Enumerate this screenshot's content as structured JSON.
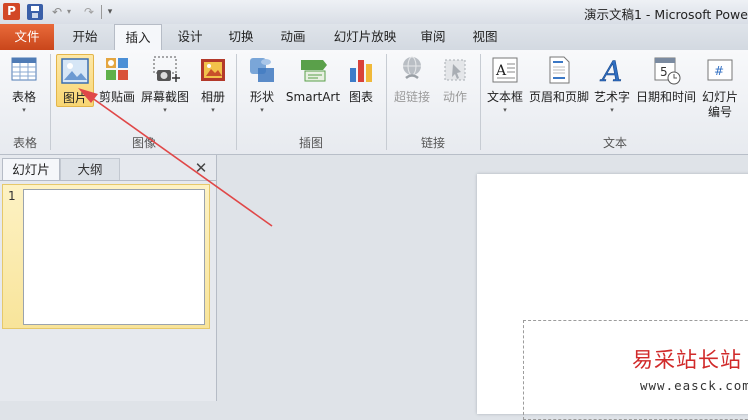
{
  "titlebar": {
    "app_icon": "P",
    "title": "演示文稿1 - Microsoft Powe",
    "icons": [
      "save-icon",
      "undo-icon",
      "redo-icon",
      "customize-qat-icon"
    ]
  },
  "tabs": [
    "文件",
    "开始",
    "插入",
    "设计",
    "切换",
    "动画",
    "幻灯片放映",
    "审阅",
    "视图"
  ],
  "active_tab": "插入",
  "ribbon": {
    "buttons": {
      "table": "表格",
      "picture": "图片",
      "clipart": "剪贴画",
      "screenshot": "屏幕截图",
      "album": "相册",
      "shapes": "形状",
      "smartart": "SmartArt",
      "chart": "图表",
      "hyperlink": "超链接",
      "action": "动作",
      "textbox": "文本框",
      "header_footer": "页眉和页脚",
      "wordart": "艺术字",
      "datetime": "日期和时间",
      "slide_number_1": "幻灯片",
      "slide_number_2": "编号"
    },
    "groups": {
      "tables": "表格",
      "images": "图像",
      "illustrations": "插图",
      "links": "链接",
      "text": "文本"
    }
  },
  "left_pane": {
    "tab_slides": "幻灯片",
    "tab_outline": "大纲",
    "close": "✕",
    "slide_number": "1"
  },
  "watermark": {
    "cn": "易采站长站",
    "url": "www.easck.com"
  },
  "colors": {
    "file_tab": "#d24726",
    "arrow": "#e04848",
    "watermark": "#d12a2a"
  }
}
